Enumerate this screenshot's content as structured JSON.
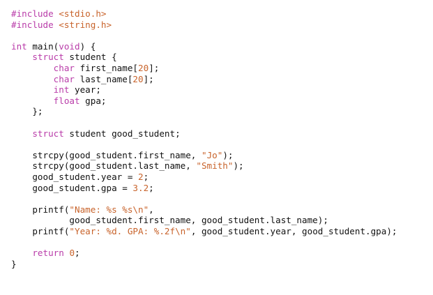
{
  "colors": {
    "background": "#ffffff",
    "default": "#111111",
    "keyword": "#b93ca9",
    "string": "#c8632b",
    "number": "#c8632b",
    "type": "#b93ca9",
    "builtin": "#b93ca9"
  },
  "code_lines": [
    {
      "indent": "",
      "tokens": [
        {
          "t": "#include",
          "c": "keyword"
        },
        {
          "t": " ",
          "c": "default"
        },
        {
          "t": "<stdio.h>",
          "c": "string"
        }
      ]
    },
    {
      "indent": "",
      "tokens": [
        {
          "t": "#include",
          "c": "keyword"
        },
        {
          "t": " ",
          "c": "default"
        },
        {
          "t": "<string.h>",
          "c": "string"
        }
      ]
    },
    {
      "indent": "",
      "tokens": []
    },
    {
      "indent": "",
      "tokens": [
        {
          "t": "int",
          "c": "type"
        },
        {
          "t": " main(",
          "c": "default"
        },
        {
          "t": "void",
          "c": "type"
        },
        {
          "t": ") {",
          "c": "default"
        }
      ]
    },
    {
      "indent": "    ",
      "tokens": [
        {
          "t": "struct",
          "c": "keyword"
        },
        {
          "t": " student {",
          "c": "default"
        }
      ]
    },
    {
      "indent": "        ",
      "tokens": [
        {
          "t": "char",
          "c": "type"
        },
        {
          "t": " first_name[",
          "c": "default"
        },
        {
          "t": "20",
          "c": "number"
        },
        {
          "t": "];",
          "c": "default"
        }
      ]
    },
    {
      "indent": "        ",
      "tokens": [
        {
          "t": "char",
          "c": "type"
        },
        {
          "t": " last_name[",
          "c": "default"
        },
        {
          "t": "20",
          "c": "number"
        },
        {
          "t": "];",
          "c": "default"
        }
      ]
    },
    {
      "indent": "        ",
      "tokens": [
        {
          "t": "int",
          "c": "type"
        },
        {
          "t": " year;",
          "c": "default"
        }
      ]
    },
    {
      "indent": "        ",
      "tokens": [
        {
          "t": "float",
          "c": "type"
        },
        {
          "t": " gpa;",
          "c": "default"
        }
      ]
    },
    {
      "indent": "    ",
      "tokens": [
        {
          "t": "};",
          "c": "default"
        }
      ]
    },
    {
      "indent": "",
      "tokens": []
    },
    {
      "indent": "    ",
      "tokens": [
        {
          "t": "struct",
          "c": "keyword"
        },
        {
          "t": " student good_student;",
          "c": "default"
        }
      ]
    },
    {
      "indent": "",
      "tokens": []
    },
    {
      "indent": "    ",
      "tokens": [
        {
          "t": "strcpy(good_student.first_name, ",
          "c": "default"
        },
        {
          "t": "\"Jo\"",
          "c": "string"
        },
        {
          "t": ");",
          "c": "default"
        }
      ]
    },
    {
      "indent": "    ",
      "tokens": [
        {
          "t": "strcpy(good_student.last_name, ",
          "c": "default"
        },
        {
          "t": "\"Smith\"",
          "c": "string"
        },
        {
          "t": ");",
          "c": "default"
        }
      ]
    },
    {
      "indent": "    ",
      "tokens": [
        {
          "t": "good_student.year = ",
          "c": "default"
        },
        {
          "t": "2",
          "c": "number"
        },
        {
          "t": ";",
          "c": "default"
        }
      ]
    },
    {
      "indent": "    ",
      "tokens": [
        {
          "t": "good_student.gpa = ",
          "c": "default"
        },
        {
          "t": "3.2",
          "c": "number"
        },
        {
          "t": ";",
          "c": "default"
        }
      ]
    },
    {
      "indent": "",
      "tokens": []
    },
    {
      "indent": "    ",
      "tokens": [
        {
          "t": "printf(",
          "c": "default"
        },
        {
          "t": "\"Name: %s %s\\n\"",
          "c": "string"
        },
        {
          "t": ",",
          "c": "default"
        }
      ]
    },
    {
      "indent": "           ",
      "tokens": [
        {
          "t": "good_student.first_name, good_student.last_name);",
          "c": "default"
        }
      ]
    },
    {
      "indent": "    ",
      "tokens": [
        {
          "t": "printf(",
          "c": "default"
        },
        {
          "t": "\"Year: %d. GPA: %.2f\\n\"",
          "c": "string"
        },
        {
          "t": ", good_student.year, good_student.gpa);",
          "c": "default"
        }
      ]
    },
    {
      "indent": "",
      "tokens": []
    },
    {
      "indent": "    ",
      "tokens": [
        {
          "t": "return",
          "c": "keyword"
        },
        {
          "t": " ",
          "c": "default"
        },
        {
          "t": "0",
          "c": "number"
        },
        {
          "t": ";",
          "c": "default"
        }
      ]
    },
    {
      "indent": "",
      "tokens": [
        {
          "t": "}",
          "c": "default"
        }
      ]
    }
  ]
}
